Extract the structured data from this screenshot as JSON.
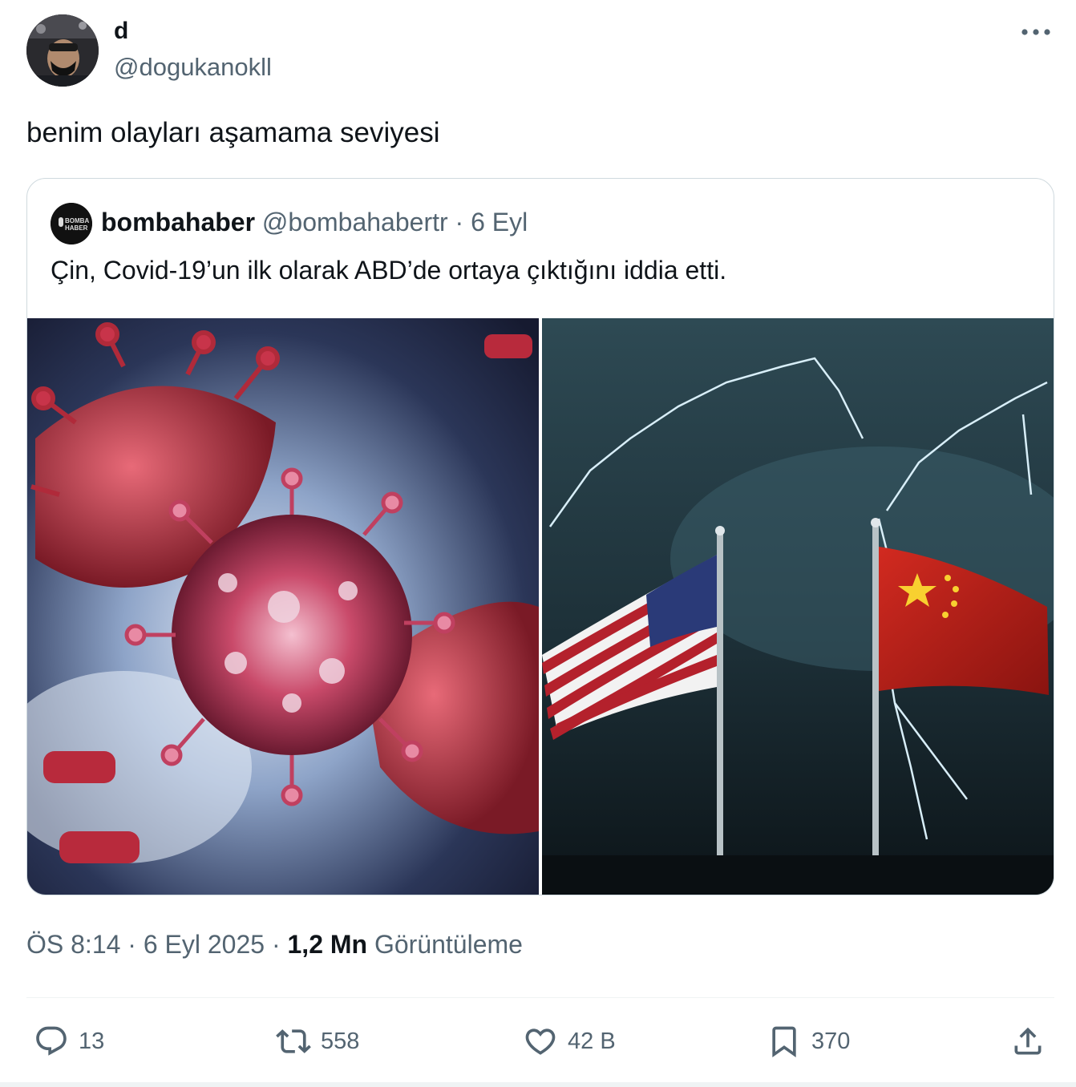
{
  "author": {
    "display_name": "d",
    "handle": "@dogukanokll"
  },
  "tweet": {
    "text": "benim olayları aşamama seviyesi"
  },
  "quoted": {
    "display_name": "bombahaber",
    "handle": "@bombahabertr",
    "separator": "·",
    "date": "6 Eyl",
    "text": "Çin, Covid-19’un ilk olarak ABD’de ortaya çıktığını iddia etti.",
    "avatar_lines": [
      "BOMBA",
      "HABER"
    ],
    "media": [
      {
        "icon": "virus-illustration"
      },
      {
        "icon": "us-china-flags-storm"
      }
    ]
  },
  "meta": {
    "time": "ÖS 8:14",
    "sep1": "·",
    "date": "6 Eyl 2025",
    "sep2": "·",
    "views_count": "1,2 Mn",
    "views_label": "Görüntüleme"
  },
  "actions": {
    "replies": "13",
    "reposts": "558",
    "likes": "42 B",
    "bookmarks": "370"
  },
  "colors": {
    "text": "#0f1419",
    "secondary": "#536471",
    "border": "#cfd9de"
  }
}
